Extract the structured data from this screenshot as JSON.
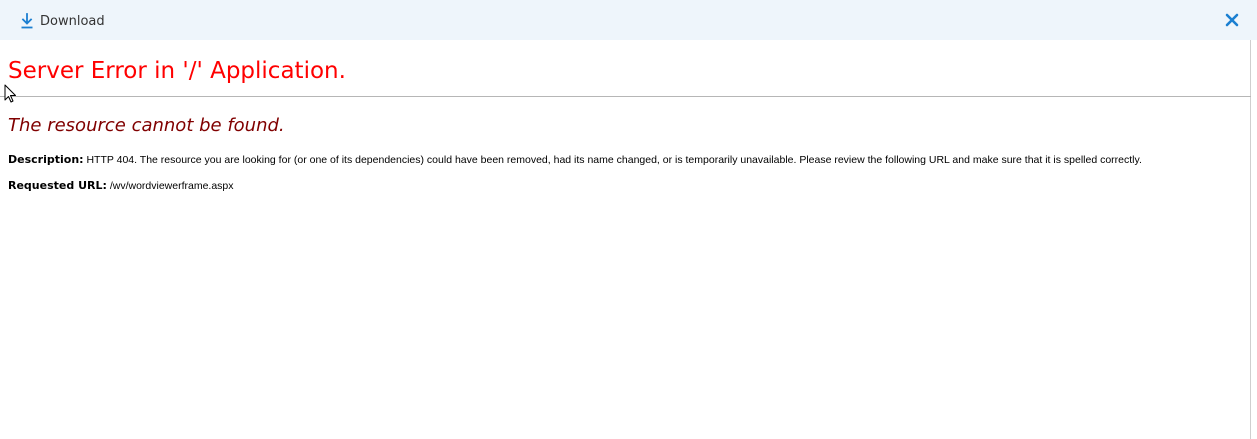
{
  "toolbar": {
    "download_label": "Download",
    "download_icon": "download-icon",
    "close_icon": "close-icon",
    "accent": "#1b7fd1",
    "background": "#eef5fb"
  },
  "error": {
    "title": "Server Error in '/' Application.",
    "subtitle": "The resource cannot be found.",
    "description_label": "Description:",
    "description_text": "HTTP 404. The resource you are looking for (or one of its dependencies) could have been removed, had its name changed, or is temporarily unavailable.  Please review the following URL and make sure that it is spelled correctly.",
    "url_label": "Requested URL:",
    "url_value": "/wv/wordviewerframe.aspx",
    "title_color": "#ff0000",
    "subtitle_color": "#800000"
  }
}
